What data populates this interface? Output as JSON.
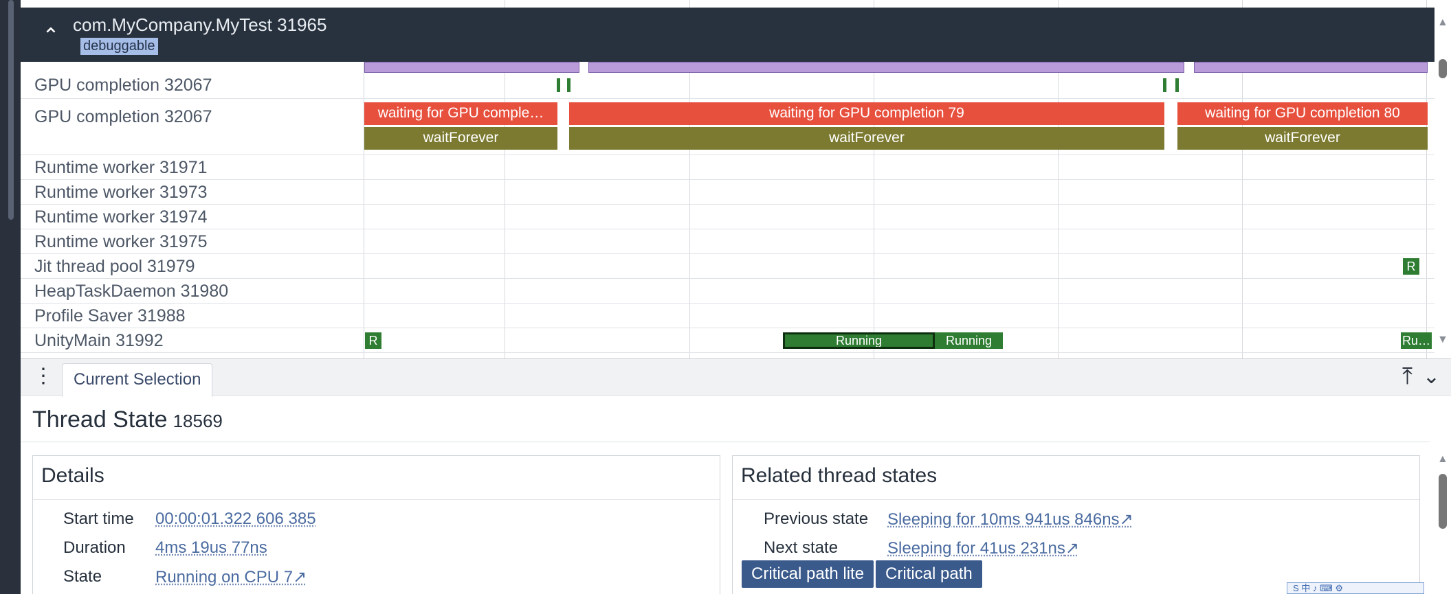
{
  "process": {
    "title": "com.MyCompany.MyTest 31965",
    "badge": "debuggable"
  },
  "tracks": [
    "GPU completion 32067",
    "GPU completion 32067",
    "Runtime worker 31971",
    "Runtime worker 31973",
    "Runtime worker 31974",
    "Runtime worker 31975",
    "Jit thread pool 31979",
    "HeapTaskDaemon 31980",
    "Profile Saver 31988",
    "UnityMain 31992"
  ],
  "slices": {
    "red": [
      "waiting for GPU comple…",
      "waiting for GPU completion 79",
      "waiting for GPU completion 80"
    ],
    "olive": [
      "waitForever",
      "waitForever",
      "waitForever"
    ]
  },
  "states": {
    "r1": "R",
    "r2": "R",
    "running1": "Running",
    "running2": "Running",
    "running3": "Ru…"
  },
  "panel": {
    "tab": "Current Selection",
    "title": "Thread State",
    "id": "18569",
    "details": {
      "heading": "Details",
      "start_label": "Start time",
      "start_value": "00:00:01.322 606 385",
      "duration_label": "Duration",
      "duration_value": "4ms 19us 77ns",
      "state_label": "State",
      "state_value": "Running on CPU 7"
    },
    "related": {
      "heading": "Related thread states",
      "prev_label": "Previous state",
      "prev_value": "Sleeping for 10ms 941us 846ns",
      "next_label": "Next state",
      "next_value": "Sleeping for 41us 231ns",
      "btn1": "Critical path lite",
      "btn2": "Critical path"
    }
  },
  "tray_text": "S 中 ♪ ⌨ ⚙",
  "icons": {
    "chevron_up": "chevron-up-icon",
    "kebab": "kebab-menu-icon",
    "pin": "pin-to-top-icon",
    "collapse": "chevron-down-icon",
    "link": "external-link-icon"
  }
}
